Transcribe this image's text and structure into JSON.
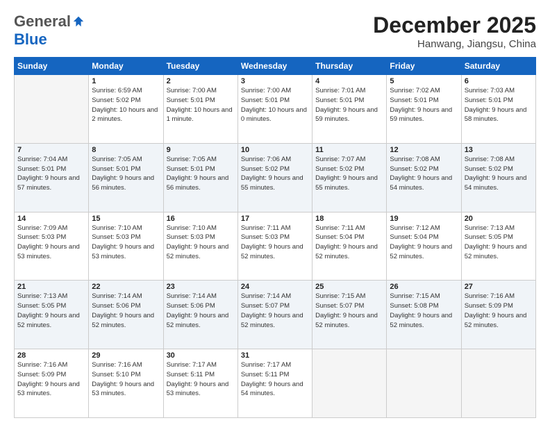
{
  "logo": {
    "general": "General",
    "blue": "Blue"
  },
  "title": "December 2025",
  "location": "Hanwang, Jiangsu, China",
  "days_header": [
    "Sunday",
    "Monday",
    "Tuesday",
    "Wednesday",
    "Thursday",
    "Friday",
    "Saturday"
  ],
  "weeks": [
    [
      {
        "day": "",
        "empty": true
      },
      {
        "day": "1",
        "sunrise": "Sunrise: 6:59 AM",
        "sunset": "Sunset: 5:02 PM",
        "daylight": "Daylight: 10 hours and 2 minutes."
      },
      {
        "day": "2",
        "sunrise": "Sunrise: 7:00 AM",
        "sunset": "Sunset: 5:01 PM",
        "daylight": "Daylight: 10 hours and 1 minute."
      },
      {
        "day": "3",
        "sunrise": "Sunrise: 7:00 AM",
        "sunset": "Sunset: 5:01 PM",
        "daylight": "Daylight: 10 hours and 0 minutes."
      },
      {
        "day": "4",
        "sunrise": "Sunrise: 7:01 AM",
        "sunset": "Sunset: 5:01 PM",
        "daylight": "Daylight: 9 hours and 59 minutes."
      },
      {
        "day": "5",
        "sunrise": "Sunrise: 7:02 AM",
        "sunset": "Sunset: 5:01 PM",
        "daylight": "Daylight: 9 hours and 59 minutes."
      },
      {
        "day": "6",
        "sunrise": "Sunrise: 7:03 AM",
        "sunset": "Sunset: 5:01 PM",
        "daylight": "Daylight: 9 hours and 58 minutes."
      }
    ],
    [
      {
        "day": "7",
        "sunrise": "Sunrise: 7:04 AM",
        "sunset": "Sunset: 5:01 PM",
        "daylight": "Daylight: 9 hours and 57 minutes."
      },
      {
        "day": "8",
        "sunrise": "Sunrise: 7:05 AM",
        "sunset": "Sunset: 5:01 PM",
        "daylight": "Daylight: 9 hours and 56 minutes."
      },
      {
        "day": "9",
        "sunrise": "Sunrise: 7:05 AM",
        "sunset": "Sunset: 5:01 PM",
        "daylight": "Daylight: 9 hours and 56 minutes."
      },
      {
        "day": "10",
        "sunrise": "Sunrise: 7:06 AM",
        "sunset": "Sunset: 5:02 PM",
        "daylight": "Daylight: 9 hours and 55 minutes."
      },
      {
        "day": "11",
        "sunrise": "Sunrise: 7:07 AM",
        "sunset": "Sunset: 5:02 PM",
        "daylight": "Daylight: 9 hours and 55 minutes."
      },
      {
        "day": "12",
        "sunrise": "Sunrise: 7:08 AM",
        "sunset": "Sunset: 5:02 PM",
        "daylight": "Daylight: 9 hours and 54 minutes."
      },
      {
        "day": "13",
        "sunrise": "Sunrise: 7:08 AM",
        "sunset": "Sunset: 5:02 PM",
        "daylight": "Daylight: 9 hours and 54 minutes."
      }
    ],
    [
      {
        "day": "14",
        "sunrise": "Sunrise: 7:09 AM",
        "sunset": "Sunset: 5:03 PM",
        "daylight": "Daylight: 9 hours and 53 minutes."
      },
      {
        "day": "15",
        "sunrise": "Sunrise: 7:10 AM",
        "sunset": "Sunset: 5:03 PM",
        "daylight": "Daylight: 9 hours and 53 minutes."
      },
      {
        "day": "16",
        "sunrise": "Sunrise: 7:10 AM",
        "sunset": "Sunset: 5:03 PM",
        "daylight": "Daylight: 9 hours and 52 minutes."
      },
      {
        "day": "17",
        "sunrise": "Sunrise: 7:11 AM",
        "sunset": "Sunset: 5:03 PM",
        "daylight": "Daylight: 9 hours and 52 minutes."
      },
      {
        "day": "18",
        "sunrise": "Sunrise: 7:11 AM",
        "sunset": "Sunset: 5:04 PM",
        "daylight": "Daylight: 9 hours and 52 minutes."
      },
      {
        "day": "19",
        "sunrise": "Sunrise: 7:12 AM",
        "sunset": "Sunset: 5:04 PM",
        "daylight": "Daylight: 9 hours and 52 minutes."
      },
      {
        "day": "20",
        "sunrise": "Sunrise: 7:13 AM",
        "sunset": "Sunset: 5:05 PM",
        "daylight": "Daylight: 9 hours and 52 minutes."
      }
    ],
    [
      {
        "day": "21",
        "sunrise": "Sunrise: 7:13 AM",
        "sunset": "Sunset: 5:05 PM",
        "daylight": "Daylight: 9 hours and 52 minutes."
      },
      {
        "day": "22",
        "sunrise": "Sunrise: 7:14 AM",
        "sunset": "Sunset: 5:06 PM",
        "daylight": "Daylight: 9 hours and 52 minutes."
      },
      {
        "day": "23",
        "sunrise": "Sunrise: 7:14 AM",
        "sunset": "Sunset: 5:06 PM",
        "daylight": "Daylight: 9 hours and 52 minutes."
      },
      {
        "day": "24",
        "sunrise": "Sunrise: 7:14 AM",
        "sunset": "Sunset: 5:07 PM",
        "daylight": "Daylight: 9 hours and 52 minutes."
      },
      {
        "day": "25",
        "sunrise": "Sunrise: 7:15 AM",
        "sunset": "Sunset: 5:07 PM",
        "daylight": "Daylight: 9 hours and 52 minutes."
      },
      {
        "day": "26",
        "sunrise": "Sunrise: 7:15 AM",
        "sunset": "Sunset: 5:08 PM",
        "daylight": "Daylight: 9 hours and 52 minutes."
      },
      {
        "day": "27",
        "sunrise": "Sunrise: 7:16 AM",
        "sunset": "Sunset: 5:09 PM",
        "daylight": "Daylight: 9 hours and 52 minutes."
      }
    ],
    [
      {
        "day": "28",
        "sunrise": "Sunrise: 7:16 AM",
        "sunset": "Sunset: 5:09 PM",
        "daylight": "Daylight: 9 hours and 53 minutes."
      },
      {
        "day": "29",
        "sunrise": "Sunrise: 7:16 AM",
        "sunset": "Sunset: 5:10 PM",
        "daylight": "Daylight: 9 hours and 53 minutes."
      },
      {
        "day": "30",
        "sunrise": "Sunrise: 7:17 AM",
        "sunset": "Sunset: 5:11 PM",
        "daylight": "Daylight: 9 hours and 53 minutes."
      },
      {
        "day": "31",
        "sunrise": "Sunrise: 7:17 AM",
        "sunset": "Sunset: 5:11 PM",
        "daylight": "Daylight: 9 hours and 54 minutes."
      },
      {
        "day": "",
        "empty": true
      },
      {
        "day": "",
        "empty": true
      },
      {
        "day": "",
        "empty": true
      }
    ]
  ]
}
